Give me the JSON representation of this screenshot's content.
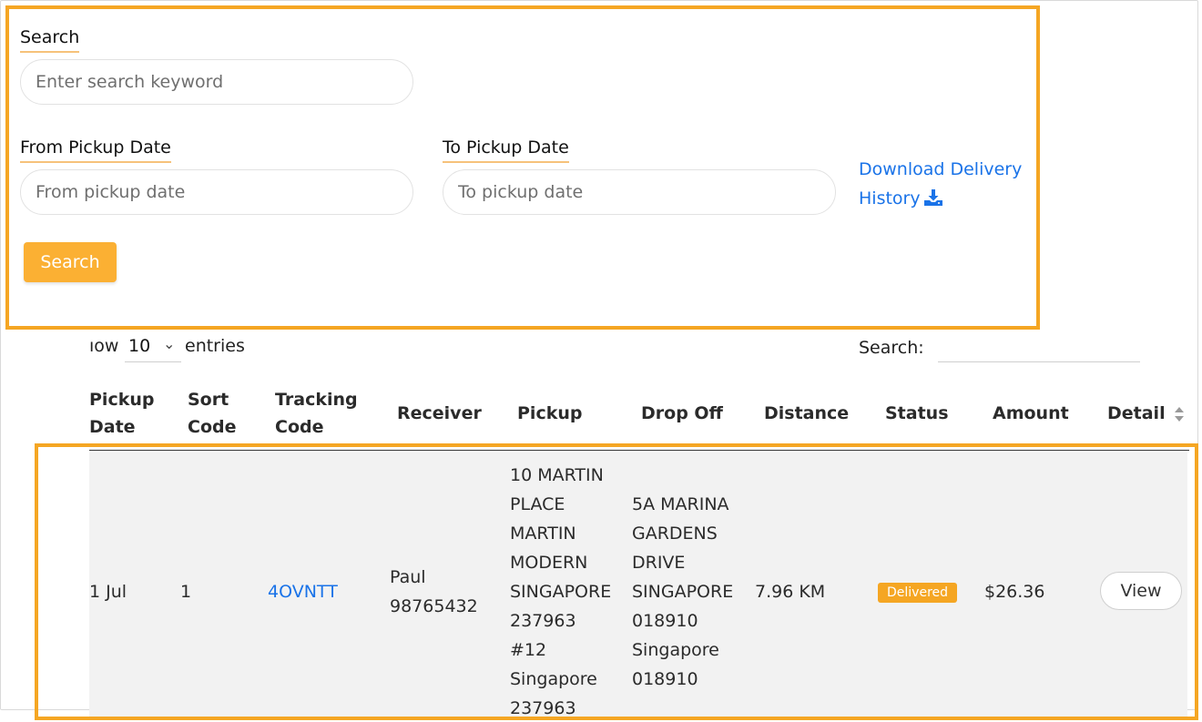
{
  "filters": {
    "search_label": "Search",
    "search_placeholder": "Enter search keyword",
    "from_label": "From Pickup Date",
    "from_placeholder": "From pickup date",
    "to_label": "To Pickup Date",
    "to_placeholder": "To pickup date",
    "download_line1": "Download Delivery",
    "download_line2": "History",
    "search_button": "Search"
  },
  "table_controls": {
    "show_prefix": "ıow",
    "entries_value": "10",
    "entries_suffix": "entries",
    "search_label": "Search:"
  },
  "table": {
    "columns": [
      {
        "line1": "Pickup",
        "line2": "Date"
      },
      {
        "line1": "Sort",
        "line2": "Code"
      },
      {
        "line1": "Tracking",
        "line2": "Code"
      },
      {
        "line1": "Receiver",
        "line2": ""
      },
      {
        "line1": "Pickup",
        "line2": ""
      },
      {
        "line1": "Drop Off",
        "line2": ""
      },
      {
        "line1": "Distance",
        "line2": ""
      },
      {
        "line1": "Status",
        "line2": ""
      },
      {
        "line1": "Amount",
        "line2": ""
      },
      {
        "line1": "Detail",
        "line2": ""
      }
    ],
    "rows": [
      {
        "pickup_date": "1 Jul",
        "sort_code": "1",
        "tracking_code": "4OVNTT",
        "receiver": [
          "Paul",
          "98765432"
        ],
        "pickup": [
          "10 MARTIN",
          "PLACE",
          "MARTIN",
          "MODERN",
          "SINGAPORE",
          "237963",
          "#12",
          "Singapore",
          "237963"
        ],
        "dropoff": [
          "5A MARINA",
          "GARDENS",
          "DRIVE",
          "SINGAPORE",
          "018910",
          "Singapore",
          "018910"
        ],
        "distance": "7.96 KM",
        "status": "Delivered",
        "amount": "$26.36",
        "detail": "View"
      }
    ]
  },
  "colors": {
    "accent": "#f5a623",
    "button": "#fbb033",
    "link": "#1a73e8"
  },
  "icons": {
    "download": "download-icon",
    "sort": "sort-icon",
    "chevron": "chevron-down-icon"
  }
}
